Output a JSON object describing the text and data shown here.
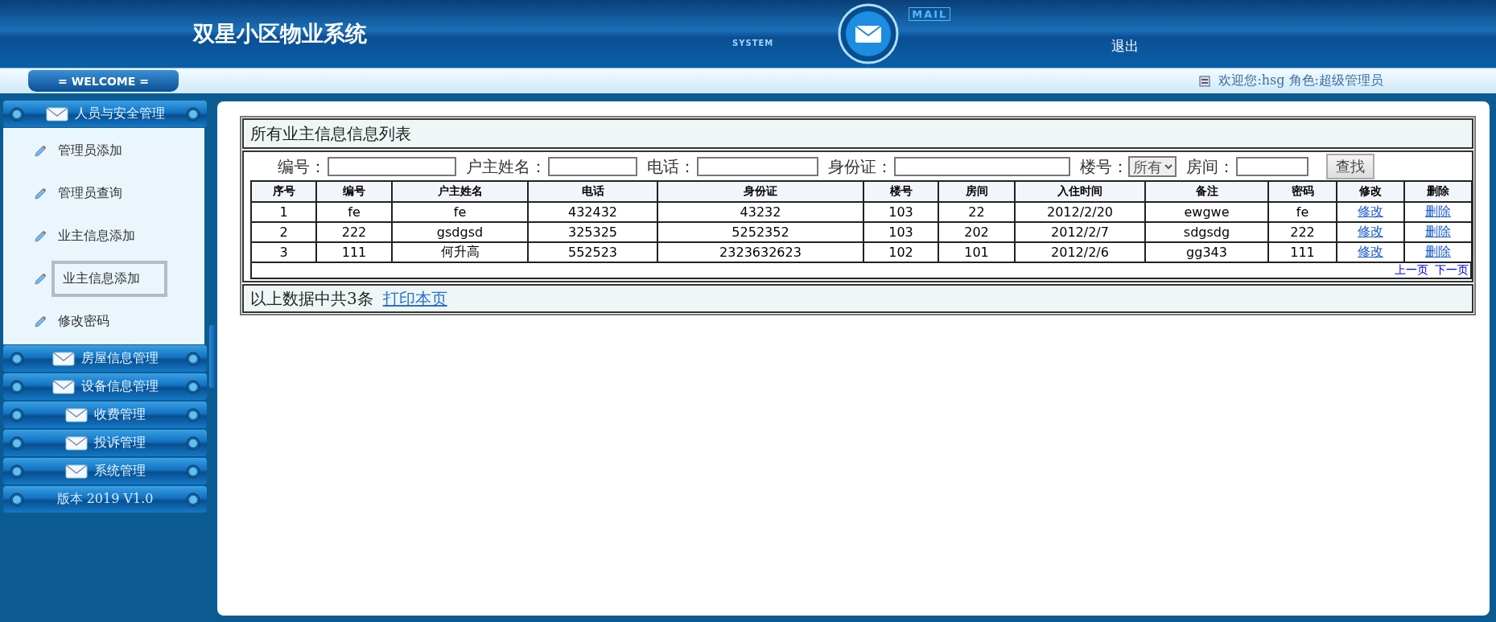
{
  "header": {
    "title": "双星小区物业系统",
    "logo_texts": [
      "SYSTEM",
      "MAIL"
    ],
    "logout": "退出"
  },
  "welcome_bar": {
    "tab": "= WELCOME =",
    "greeting": "欢迎您:hsg 角色:超级管理员"
  },
  "sidebar": {
    "groups": [
      {
        "label": "人员与安全管理",
        "items": [
          {
            "label": "管理员添加",
            "selected": false
          },
          {
            "label": "管理员查询",
            "selected": false
          },
          {
            "label": "业主信息添加",
            "selected": false
          },
          {
            "label": "业主信息添加",
            "selected": true
          },
          {
            "label": "修改密码",
            "selected": false
          }
        ]
      },
      {
        "label": "房屋信息管理"
      },
      {
        "label": "设备信息管理"
      },
      {
        "label": "收费管理"
      },
      {
        "label": "投诉管理"
      },
      {
        "label": "系统管理"
      }
    ],
    "version": "版本 2019 V1.0"
  },
  "panel": {
    "title": "所有业主信息信息列表",
    "search": {
      "fields": [
        {
          "label": "编号：",
          "kind": "text"
        },
        {
          "label": "户主姓名：",
          "kind": "text"
        },
        {
          "label": "电话：",
          "kind": "text"
        },
        {
          "label": "身份证：",
          "kind": "text"
        },
        {
          "label": "楼号：",
          "kind": "select",
          "value": "所有"
        },
        {
          "label": "房间：",
          "kind": "text"
        }
      ],
      "button": "查找"
    },
    "table": {
      "columns": [
        {
          "label": "序号",
          "kind": "text"
        },
        {
          "label": "编号",
          "kind": "text"
        },
        {
          "label": "户主姓名",
          "kind": "text"
        },
        {
          "label": "电话",
          "kind": "text"
        },
        {
          "label": "身份证",
          "kind": "text"
        },
        {
          "label": "楼号",
          "kind": "text"
        },
        {
          "label": "房间",
          "kind": "text"
        },
        {
          "label": "入住时间",
          "kind": "text"
        },
        {
          "label": "备注",
          "kind": "text"
        },
        {
          "label": "密码",
          "kind": "text"
        },
        {
          "label": "修改",
          "kind": "link"
        },
        {
          "label": "删除",
          "kind": "link"
        }
      ],
      "rows": [
        [
          "1",
          "fe",
          "fe",
          "432432",
          "43232",
          "103",
          "22",
          "2012/2/20",
          "ewgwe",
          "fe",
          "修改",
          "删除"
        ],
        [
          "2",
          "222",
          "gsdgsd",
          "325325",
          "5252352",
          "103",
          "202",
          "2012/2/7",
          "sdgsdg",
          "222",
          "修改",
          "删除"
        ],
        [
          "3",
          "111",
          "何升高",
          "552523",
          "2323632623",
          "102",
          "101",
          "2012/2/6",
          "gg343",
          "111",
          "修改",
          "删除"
        ]
      ]
    },
    "pager": [
      "上一页",
      "下一页"
    ],
    "footer": {
      "summary": "以上数据中共3条",
      "link": "打印本页"
    }
  }
}
